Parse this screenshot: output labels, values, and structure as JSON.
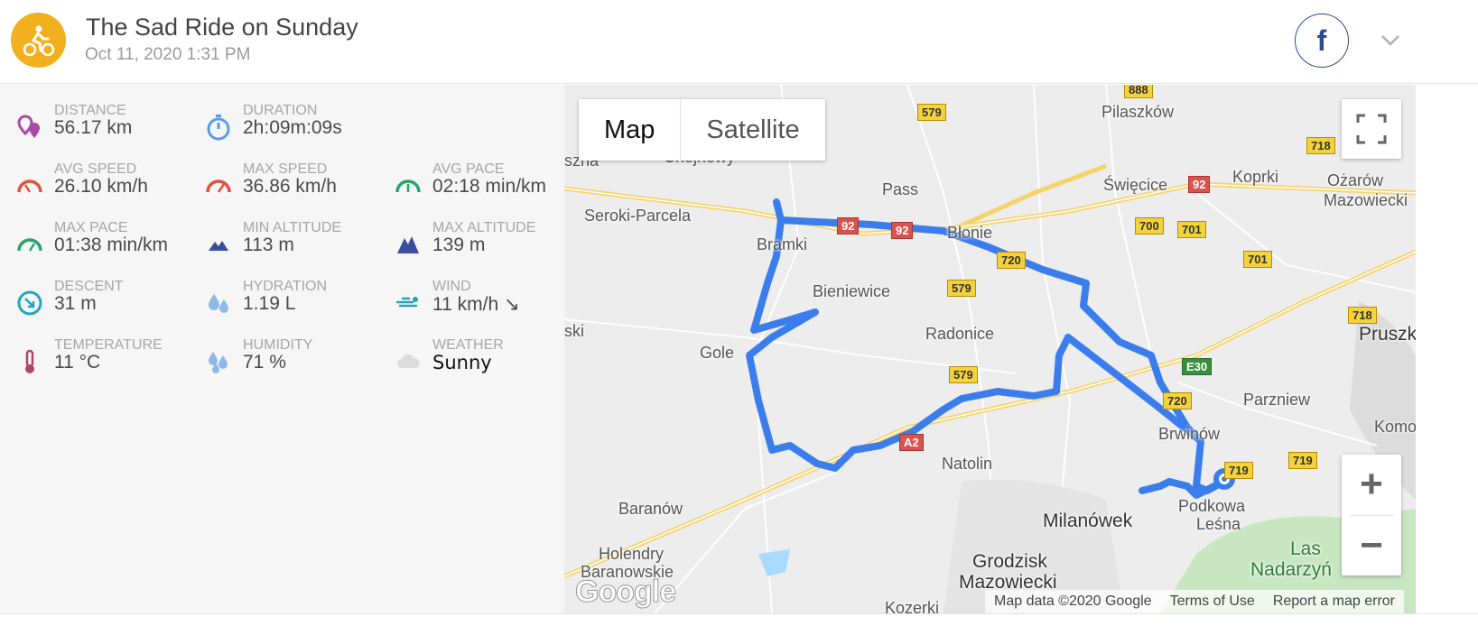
{
  "header": {
    "title": "The Sad Ride on Sunday",
    "datetime": "Oct 11, 2020 1:31 PM",
    "activity_icon": "bicycle-icon",
    "share_icon": "facebook-icon",
    "share_label": "f",
    "expand_icon": "chevron-down-icon",
    "accent_color": "#f2b01e"
  },
  "stats": [
    {
      "label": "DISTANCE",
      "value": "56.17 km",
      "icon": "distance-pins-icon"
    },
    {
      "label": "DURATION",
      "value": "2h:09m:09s",
      "icon": "stopwatch-icon"
    },
    {
      "label": "AVG SPEED",
      "value": "26.10 km/h",
      "icon": "speedometer-icon"
    },
    {
      "label": "MAX SPEED",
      "value": "36.86 km/h",
      "icon": "speedometer-icon"
    },
    {
      "label": "AVG PACE",
      "value": "02:18 min/km",
      "icon": "pace-gauge-icon"
    },
    {
      "label": "MAX PACE",
      "value": "01:38 min/km",
      "icon": "pace-gauge-icon"
    },
    {
      "label": "MIN ALTITUDE",
      "value": "113 m",
      "icon": "mountain-icon"
    },
    {
      "label": "MAX ALTITUDE",
      "value": "139 m",
      "icon": "mountain-icon"
    },
    {
      "label": "DESCENT",
      "value": "31 m",
      "icon": "descent-icon"
    },
    {
      "label": "HYDRATION",
      "value": "1.19 L",
      "icon": "water-drops-icon"
    },
    {
      "label": "WIND",
      "value": "11 km/h ↘",
      "icon": "wind-icon"
    },
    {
      "label": "TEMPERATURE",
      "value": "11 °C",
      "icon": "thermometer-icon"
    },
    {
      "label": "HUMIDITY",
      "value": "71 %",
      "icon": "humidity-drops-icon"
    },
    {
      "label": "WEATHER",
      "value": "Sunny",
      "icon": "cloud-icon"
    }
  ],
  "map": {
    "type_buttons": [
      "Map",
      "Satellite"
    ],
    "selected_type": "Map",
    "zoom_in": "+",
    "zoom_out": "−",
    "attribution": [
      "Map data ©2020 Google",
      "Terms of Use",
      "Report a map error"
    ],
    "logo": "Google",
    "route_color": "#3b7ded",
    "places": [
      "Pilaszków",
      "Koprki",
      "Ożarów",
      "Mazowiecki",
      "Święcice",
      "Pass",
      "Seroki-Parcela",
      "szna",
      "Bramki",
      "Błonie",
      "Bieniewice",
      "Radonice",
      "ski",
      "Gole",
      "Pruszk",
      "Parzniew",
      "Komo",
      "Brwinów",
      "Natolin",
      "Baranów",
      "Milanówek",
      "Podkowa",
      "Leśna",
      "Holendry",
      "Baranowskie",
      "Grodzisk",
      "Mazowiecki",
      "Las",
      "Nadarzyń",
      "Kozerki",
      "Chojnowy"
    ],
    "road_shields": [
      "888",
      "579",
      "718",
      "92",
      "700",
      "701",
      "701",
      "92",
      "92",
      "720",
      "579",
      "718",
      "E30",
      "720",
      "579",
      "A2",
      "719",
      "719"
    ]
  }
}
